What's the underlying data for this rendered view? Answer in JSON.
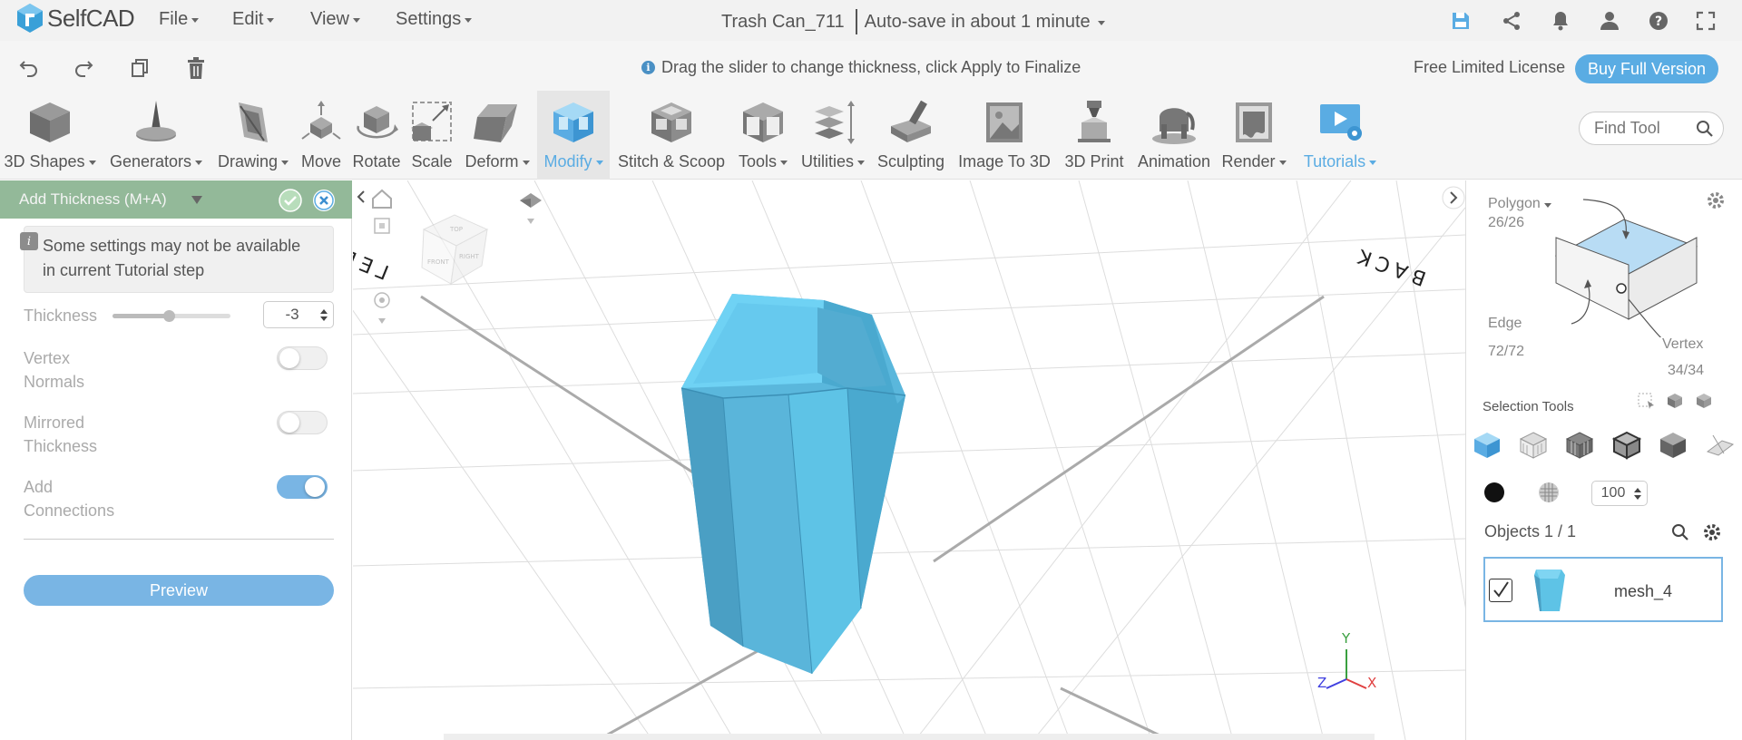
{
  "app": {
    "logo_text": "SelfCAD"
  },
  "menu": {
    "file": "File",
    "edit": "Edit",
    "view": "View",
    "settings": "Settings"
  },
  "title": {
    "project": "Trash Can_711",
    "autosave": "Auto-save in about 1 minute"
  },
  "hint": "Drag the slider to change thickness, click Apply to Finalize",
  "license": {
    "text": "Free Limited License",
    "buy": "Buy Full Version"
  },
  "toolbar": {
    "shapes": "3D Shapes",
    "generators": "Generators",
    "drawing": "Drawing",
    "move": "Move",
    "rotate": "Rotate",
    "scale": "Scale",
    "deform": "Deform",
    "modify": "Modify",
    "stitch": "Stitch & Scoop",
    "tools": "Tools",
    "utilities": "Utilities",
    "sculpting": "Sculpting",
    "image3d": "Image To 3D",
    "print": "3D Print",
    "animation": "Animation",
    "render": "Render",
    "tutorials": "Tutorials",
    "find_placeholder": "Find Tool"
  },
  "panel": {
    "title": "Add Thickness (M+A)",
    "info": "Some settings may not be available in current Tutorial step",
    "thickness_label": "Thickness",
    "thickness_value": "-3",
    "thickness_slider": 0.48,
    "vertex_normals": "Vertex Normals",
    "vertex_normals_on": false,
    "mirrored": "Mirrored Thickness",
    "mirrored_on": false,
    "connections": "Add Connections",
    "connections_on": true,
    "preview": "Preview"
  },
  "viewport": {
    "left_label": "LEFT",
    "back_label": "BACK",
    "axis_x": "X",
    "axis_y": "Y",
    "axis_z": "Z",
    "cube_front": "FRONT",
    "cube_right": "RIGHT",
    "cube_top": "TOP"
  },
  "right": {
    "polygon": "Polygon",
    "polygon_count": "26/26",
    "edge": "Edge",
    "edge_count": "72/72",
    "vertex": "Vertex",
    "vertex_count": "34/34",
    "selection_tools": "Selection Tools",
    "opacity_value": "100",
    "objects": "Objects 1 / 1",
    "object_name": "mesh_4"
  },
  "colors": {
    "accent": "#5aace3",
    "panel_header": "#93b999",
    "mesh": "#5ec3e6"
  }
}
